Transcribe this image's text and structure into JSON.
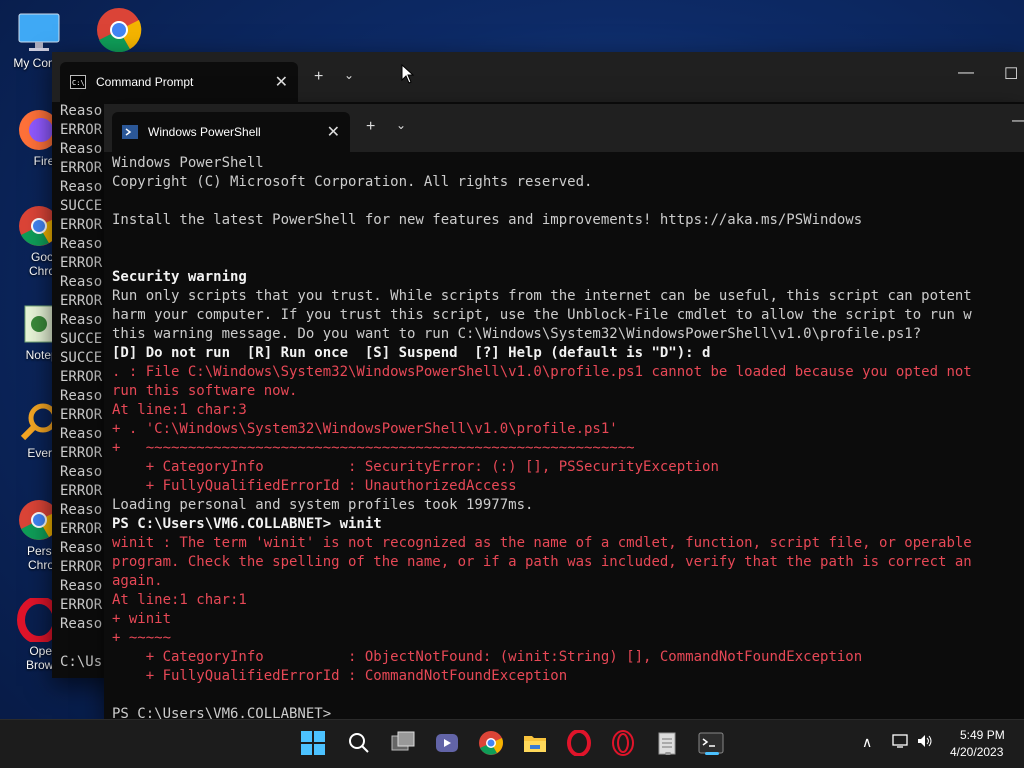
{
  "desktop": {
    "icons": [
      {
        "label": "My Comp"
      },
      {
        "label": ""
      },
      {
        "label": "Firefo"
      },
      {
        "label": "Googl\nChrom"
      },
      {
        "label": "Notepac"
      },
      {
        "label": "Everythi"
      },
      {
        "label": "Person\nChrom"
      },
      {
        "label": "Opera\nBrowse"
      }
    ]
  },
  "cmd_window": {
    "tab_title": "Command Prompt",
    "lines": [
      "Reaso",
      "ERROR",
      "Reaso",
      "ERROR",
      "Reaso",
      "SUCCE",
      "ERROR",
      "Reaso",
      "ERROR",
      "Reaso",
      "ERROR",
      "Reaso",
      "SUCCE",
      "SUCCE",
      "ERROR",
      "Reaso",
      "ERROR",
      "Reaso",
      "ERROR",
      "Reaso",
      "ERROR",
      "Reaso",
      "ERROR",
      "Reaso",
      "ERROR",
      "Reaso",
      "ERROR",
      "Reaso",
      "",
      "C:\\Us"
    ]
  },
  "ps_window": {
    "tab_title": "Windows PowerShell",
    "lines": [
      {
        "t": "Windows PowerShell",
        "c": "n"
      },
      {
        "t": "Copyright (C) Microsoft Corporation. All rights reserved.",
        "c": "n"
      },
      {
        "t": "",
        "c": "n"
      },
      {
        "t": "Install the latest PowerShell for new features and improvements! https://aka.ms/PSWindows",
        "c": "n"
      },
      {
        "t": "",
        "c": "n"
      },
      {
        "t": "",
        "c": "n"
      },
      {
        "t": "Security warning",
        "c": "b"
      },
      {
        "t": "Run only scripts that you trust. While scripts from the internet can be useful, this script can potent",
        "c": "n"
      },
      {
        "t": "harm your computer. If you trust this script, use the Unblock-File cmdlet to allow the script to run w",
        "c": "n"
      },
      {
        "t": "this warning message. Do you want to run C:\\Windows\\System32\\WindowsPowerShell\\v1.0\\profile.ps1?",
        "c": "n"
      },
      {
        "t": "[D] Do not run  [R] Run once  [S] Suspend  [?] Help (default is \"D\"): d",
        "c": "b"
      },
      {
        "t": ". : File C:\\Windows\\System32\\WindowsPowerShell\\v1.0\\profile.ps1 cannot be loaded because you opted not",
        "c": "e"
      },
      {
        "t": "run this software now.",
        "c": "e"
      },
      {
        "t": "At line:1 char:3",
        "c": "e"
      },
      {
        "t": "+ . 'C:\\Windows\\System32\\WindowsPowerShell\\v1.0\\profile.ps1'",
        "c": "e"
      },
      {
        "t": "+   ~~~~~~~~~~~~~~~~~~~~~~~~~~~~~~~~~~~~~~~~~~~~~~~~~~~~~~~~~~",
        "c": "e"
      },
      {
        "t": "    + CategoryInfo          : SecurityError: (:) [], PSSecurityException",
        "c": "e"
      },
      {
        "t": "    + FullyQualifiedErrorId : UnauthorizedAccess",
        "c": "e"
      },
      {
        "t": "Loading personal and system profiles took 19977ms.",
        "c": "n"
      },
      {
        "t": "PS C:\\Users\\VM6.COLLABNET> winit",
        "c": "b"
      },
      {
        "t": "winit : The term 'winit' is not recognized as the name of a cmdlet, function, script file, or operable",
        "c": "e"
      },
      {
        "t": "program. Check the spelling of the name, or if a path was included, verify that the path is correct an",
        "c": "e"
      },
      {
        "t": "again.",
        "c": "e"
      },
      {
        "t": "At line:1 char:1",
        "c": "e"
      },
      {
        "t": "+ winit",
        "c": "e"
      },
      {
        "t": "+ ~~~~~",
        "c": "e"
      },
      {
        "t": "    + CategoryInfo          : ObjectNotFound: (winit:String) [], CommandNotFoundException",
        "c": "e"
      },
      {
        "t": "    + FullyQualifiedErrorId : CommandNotFoundException",
        "c": "e"
      },
      {
        "t": "",
        "c": "n"
      },
      {
        "t": "PS C:\\Users\\VM6.COLLABNET>",
        "c": "n"
      }
    ]
  },
  "taskbar": {
    "apps": [
      "start",
      "search",
      "task-view",
      "teams",
      "chrome",
      "file-explorer",
      "opera",
      "opera-gx",
      "notepad",
      "terminal"
    ],
    "time": "5:49 PM",
    "date": "4/20/2023"
  },
  "colors": {
    "error": "#e74856",
    "text": "#cccccc",
    "bright": "#f2f2f2"
  }
}
